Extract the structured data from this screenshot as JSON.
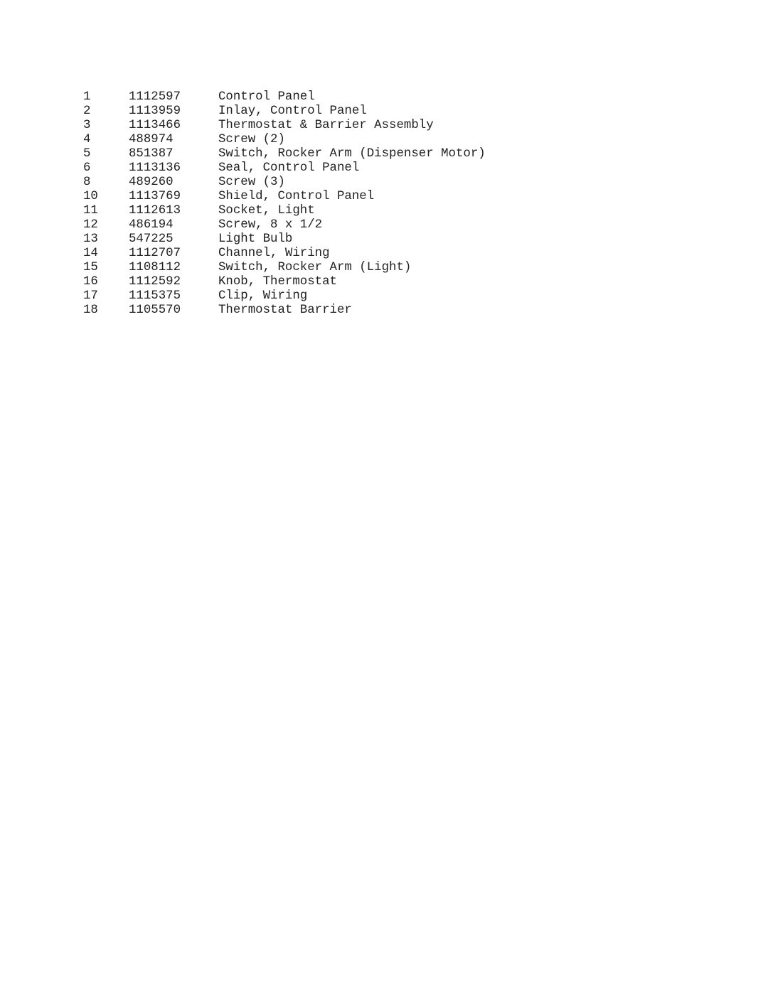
{
  "parts": [
    {
      "ref": "1",
      "part_no": "1112597",
      "description": "Control Panel"
    },
    {
      "ref": "2",
      "part_no": "1113959",
      "description": "Inlay, Control Panel"
    },
    {
      "ref": "3",
      "part_no": "1113466",
      "description": "Thermostat & Barrier Assembly"
    },
    {
      "ref": "4",
      "part_no": "488974",
      "description": "Screw (2)"
    },
    {
      "ref": "5",
      "part_no": "851387",
      "description": "Switch, Rocker Arm (Dispenser Motor)"
    },
    {
      "ref": "6",
      "part_no": "1113136",
      "description": "Seal, Control Panel"
    },
    {
      "ref": "8",
      "part_no": "489260",
      "description": "Screw (3)"
    },
    {
      "ref": "10",
      "part_no": "1113769",
      "description": "Shield, Control Panel"
    },
    {
      "ref": "11",
      "part_no": "1112613",
      "description": "Socket, Light"
    },
    {
      "ref": "12",
      "part_no": "486194",
      "description": "Screw, 8 x 1/2"
    },
    {
      "ref": "13",
      "part_no": "547225",
      "description": "Light Bulb"
    },
    {
      "ref": "14",
      "part_no": "1112707",
      "description": "Channel, Wiring"
    },
    {
      "ref": "15",
      "part_no": "1108112",
      "description": "Switch, Rocker Arm (Light)"
    },
    {
      "ref": "16",
      "part_no": "1112592",
      "description": "Knob, Thermostat"
    },
    {
      "ref": "17",
      "part_no": "1115375",
      "description": "Clip, Wiring"
    },
    {
      "ref": "18",
      "part_no": "1105570",
      "description": "Thermostat Barrier"
    }
  ]
}
